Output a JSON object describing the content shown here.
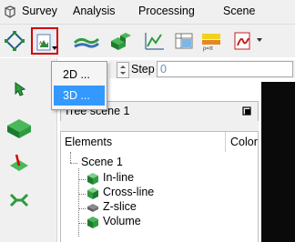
{
  "menubar": {
    "items": [
      {
        "label": "Survey"
      },
      {
        "label": "Analysis"
      },
      {
        "label": "Processing"
      },
      {
        "label": "Scene"
      }
    ]
  },
  "dropdown": {
    "items": [
      {
        "label": "2D ..."
      },
      {
        "label": "3D ..."
      }
    ],
    "selected_index": 1
  },
  "stepbar": {
    "label": "Step",
    "value": "0"
  },
  "tree": {
    "title": "Tree scene 1",
    "columns": {
      "elements": "Elements",
      "color": "Color"
    },
    "root": "Scene 1",
    "children": [
      {
        "label": "In-line",
        "icon": "inline-cube-icon"
      },
      {
        "label": "Cross-line",
        "icon": "crossline-cube-icon"
      },
      {
        "label": "Z-slice",
        "icon": "zslice-icon"
      },
      {
        "label": "Volume",
        "icon": "volume-cube-icon"
      }
    ]
  },
  "colors": {
    "highlight": "#3399ff",
    "menubar_bg": "#f0f0f0",
    "active_button_border": "#d40000",
    "cube_green": "#2e9b3e",
    "viewport_dark": "#0a0a0a"
  }
}
